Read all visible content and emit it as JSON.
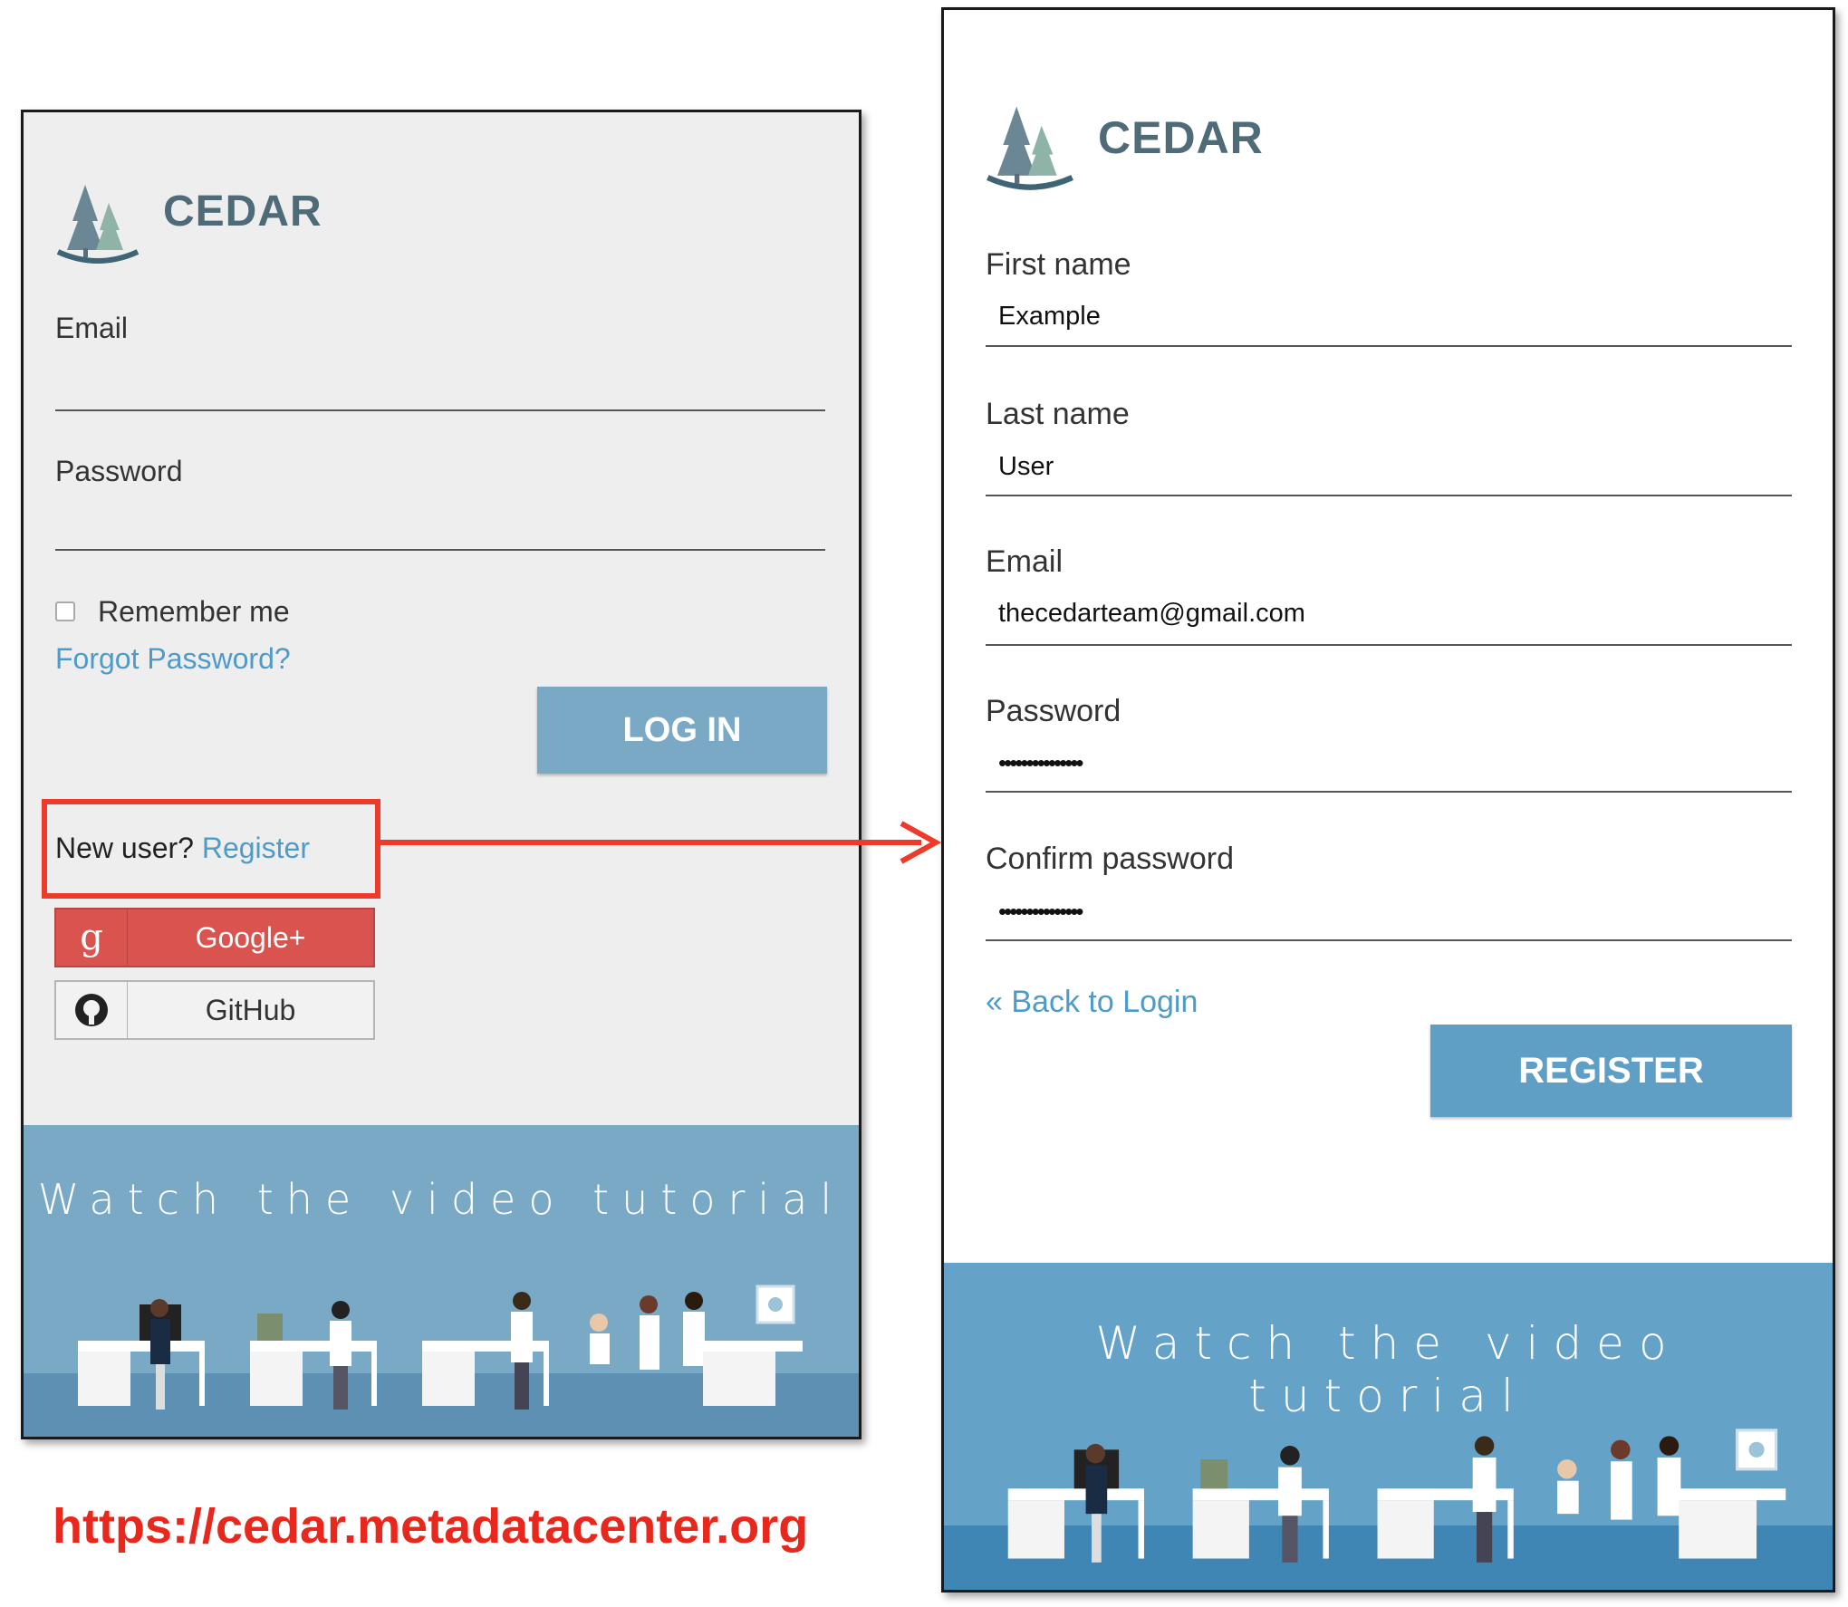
{
  "login": {
    "logo_text": "CEDAR",
    "email_label": "Email",
    "password_label": "Password",
    "remember_label": "Remember me",
    "forgot_link": "Forgot Password?",
    "login_button": "LOG IN",
    "new_user_text": "New user?",
    "register_link": "Register",
    "google_button": "Google+",
    "google_icon_glyph": "g",
    "github_button": "GitHub",
    "tutorial_text": "Watch the video tutorial"
  },
  "register": {
    "logo_text": "CEDAR",
    "first_name_label": "First name",
    "first_name_value": "Example",
    "last_name_label": "Last name",
    "last_name_value": "User",
    "email_label": "Email",
    "email_value": "thecedarteam@gmail.com",
    "password_label": "Password",
    "password_value": "•••••••••••••••",
    "confirm_label": "Confirm password",
    "confirm_value": "•••••••••••••••",
    "back_link": "« Back to Login",
    "register_button": "REGISTER",
    "tutorial_text": "Watch the video tutorial"
  },
  "footer": {
    "url": "https://cedar.metadatacenter.org"
  },
  "colors": {
    "brand_blue": "#7aa9c6",
    "link_blue": "#4f9bc8",
    "google_red": "#d9534f",
    "annotation_red": "#ee3a2a",
    "logo_gray": "#4f6b78"
  },
  "icons": {
    "logo": "pine-trees-icon",
    "google": "google-plus-icon",
    "github": "github-icon",
    "arrow": "arrow-right-icon"
  }
}
